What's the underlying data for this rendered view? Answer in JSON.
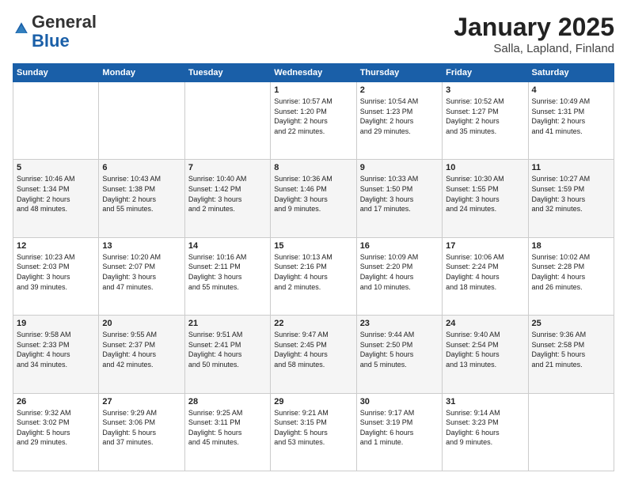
{
  "header": {
    "logo": {
      "line1": "General",
      "line2": "Blue"
    },
    "title": "January 2025",
    "location": "Salla, Lapland, Finland"
  },
  "days_of_week": [
    "Sunday",
    "Monday",
    "Tuesday",
    "Wednesday",
    "Thursday",
    "Friday",
    "Saturday"
  ],
  "weeks": [
    [
      {
        "day": "",
        "info": ""
      },
      {
        "day": "",
        "info": ""
      },
      {
        "day": "",
        "info": ""
      },
      {
        "day": "1",
        "info": "Sunrise: 10:57 AM\nSunset: 1:20 PM\nDaylight: 2 hours\nand 22 minutes."
      },
      {
        "day": "2",
        "info": "Sunrise: 10:54 AM\nSunset: 1:23 PM\nDaylight: 2 hours\nand 29 minutes."
      },
      {
        "day": "3",
        "info": "Sunrise: 10:52 AM\nSunset: 1:27 PM\nDaylight: 2 hours\nand 35 minutes."
      },
      {
        "day": "4",
        "info": "Sunrise: 10:49 AM\nSunset: 1:31 PM\nDaylight: 2 hours\nand 41 minutes."
      }
    ],
    [
      {
        "day": "5",
        "info": "Sunrise: 10:46 AM\nSunset: 1:34 PM\nDaylight: 2 hours\nand 48 minutes."
      },
      {
        "day": "6",
        "info": "Sunrise: 10:43 AM\nSunset: 1:38 PM\nDaylight: 2 hours\nand 55 minutes."
      },
      {
        "day": "7",
        "info": "Sunrise: 10:40 AM\nSunset: 1:42 PM\nDaylight: 3 hours\nand 2 minutes."
      },
      {
        "day": "8",
        "info": "Sunrise: 10:36 AM\nSunset: 1:46 PM\nDaylight: 3 hours\nand 9 minutes."
      },
      {
        "day": "9",
        "info": "Sunrise: 10:33 AM\nSunset: 1:50 PM\nDaylight: 3 hours\nand 17 minutes."
      },
      {
        "day": "10",
        "info": "Sunrise: 10:30 AM\nSunset: 1:55 PM\nDaylight: 3 hours\nand 24 minutes."
      },
      {
        "day": "11",
        "info": "Sunrise: 10:27 AM\nSunset: 1:59 PM\nDaylight: 3 hours\nand 32 minutes."
      }
    ],
    [
      {
        "day": "12",
        "info": "Sunrise: 10:23 AM\nSunset: 2:03 PM\nDaylight: 3 hours\nand 39 minutes."
      },
      {
        "day": "13",
        "info": "Sunrise: 10:20 AM\nSunset: 2:07 PM\nDaylight: 3 hours\nand 47 minutes."
      },
      {
        "day": "14",
        "info": "Sunrise: 10:16 AM\nSunset: 2:11 PM\nDaylight: 3 hours\nand 55 minutes."
      },
      {
        "day": "15",
        "info": "Sunrise: 10:13 AM\nSunset: 2:16 PM\nDaylight: 4 hours\nand 2 minutes."
      },
      {
        "day": "16",
        "info": "Sunrise: 10:09 AM\nSunset: 2:20 PM\nDaylight: 4 hours\nand 10 minutes."
      },
      {
        "day": "17",
        "info": "Sunrise: 10:06 AM\nSunset: 2:24 PM\nDaylight: 4 hours\nand 18 minutes."
      },
      {
        "day": "18",
        "info": "Sunrise: 10:02 AM\nSunset: 2:28 PM\nDaylight: 4 hours\nand 26 minutes."
      }
    ],
    [
      {
        "day": "19",
        "info": "Sunrise: 9:58 AM\nSunset: 2:33 PM\nDaylight: 4 hours\nand 34 minutes."
      },
      {
        "day": "20",
        "info": "Sunrise: 9:55 AM\nSunset: 2:37 PM\nDaylight: 4 hours\nand 42 minutes."
      },
      {
        "day": "21",
        "info": "Sunrise: 9:51 AM\nSunset: 2:41 PM\nDaylight: 4 hours\nand 50 minutes."
      },
      {
        "day": "22",
        "info": "Sunrise: 9:47 AM\nSunset: 2:45 PM\nDaylight: 4 hours\nand 58 minutes."
      },
      {
        "day": "23",
        "info": "Sunrise: 9:44 AM\nSunset: 2:50 PM\nDaylight: 5 hours\nand 5 minutes."
      },
      {
        "day": "24",
        "info": "Sunrise: 9:40 AM\nSunset: 2:54 PM\nDaylight: 5 hours\nand 13 minutes."
      },
      {
        "day": "25",
        "info": "Sunrise: 9:36 AM\nSunset: 2:58 PM\nDaylight: 5 hours\nand 21 minutes."
      }
    ],
    [
      {
        "day": "26",
        "info": "Sunrise: 9:32 AM\nSunset: 3:02 PM\nDaylight: 5 hours\nand 29 minutes."
      },
      {
        "day": "27",
        "info": "Sunrise: 9:29 AM\nSunset: 3:06 PM\nDaylight: 5 hours\nand 37 minutes."
      },
      {
        "day": "28",
        "info": "Sunrise: 9:25 AM\nSunset: 3:11 PM\nDaylight: 5 hours\nand 45 minutes."
      },
      {
        "day": "29",
        "info": "Sunrise: 9:21 AM\nSunset: 3:15 PM\nDaylight: 5 hours\nand 53 minutes."
      },
      {
        "day": "30",
        "info": "Sunrise: 9:17 AM\nSunset: 3:19 PM\nDaylight: 6 hours\nand 1 minute."
      },
      {
        "day": "31",
        "info": "Sunrise: 9:14 AM\nSunset: 3:23 PM\nDaylight: 6 hours\nand 9 minutes."
      },
      {
        "day": "",
        "info": ""
      }
    ]
  ]
}
